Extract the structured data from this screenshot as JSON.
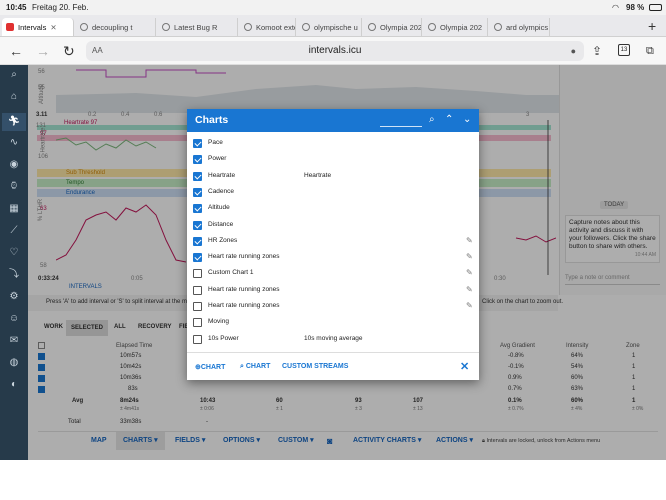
{
  "statusbar": {
    "time": "10:45",
    "date": "Freitag 20. Feb.",
    "battery": "98 %"
  },
  "tabs": [
    {
      "label": "Intervals"
    },
    {
      "label": "decoupling t"
    },
    {
      "label": "Latest Bug R"
    },
    {
      "label": "Komoot exte"
    },
    {
      "label": "olympische u"
    },
    {
      "label": "Olympia 202"
    },
    {
      "label": "Olympia 202"
    },
    {
      "label": "ard olympics"
    }
  ],
  "browser": {
    "url": "intervals.icu",
    "reader_size": "AA",
    "tab_count": "13"
  },
  "background": {
    "chart_labels": {
      "altitude": "Altitude",
      "heartrate": "Heartrate",
      "hr_pct": "% LTHR",
      "hr97": "Heartrate 97",
      "sub_threshold": "Sub Threshold",
      "tempo": "Tempo",
      "endurance": "Endurance",
      "y_56": "56",
      "y_55": "55",
      "y_311": "3.11",
      "y_131": "131",
      "y_97": "97",
      "y_106": "106",
      "y_63": "63",
      "y_58": "58",
      "x_02": "0.2",
      "x_04": "0.4",
      "x_06": "0.6",
      "x_005": "0:05",
      "x_030": "0:30",
      "x_3": "3",
      "elapsed_time": "0:33:24"
    },
    "intervals_label": "INTERVALS",
    "hint": "Press 'A' to add interval or 'S' to split interval at the mouse",
    "hint_right": "Click on the chart to zoom out.",
    "filter_tabs": [
      "WORK",
      "SELECTED",
      "ALL",
      "RECOVERY",
      "FIE"
    ],
    "table_headers": {
      "elapsed": "Elapsed Time",
      "gradient": "Avg Gradient",
      "intensity": "Intensity",
      "zone": "Zone"
    },
    "rows": [
      {
        "elapsed": "10m57s",
        "gradient": "-0.8%",
        "intensity": "64%",
        "zone": "1"
      },
      {
        "elapsed": "10m42s",
        "gradient": "-0.1%",
        "intensity": "54%",
        "zone": "1"
      },
      {
        "elapsed": "10m36s",
        "gradient": "0.9%",
        "intensity": "60%",
        "zone": "1"
      },
      {
        "elapsed": "83s",
        "gradient": "0.7%",
        "intensity": "63%",
        "zone": "1"
      }
    ],
    "avg": {
      "label": "Avg",
      "elapsed": "8m24s",
      "elapsed_sub": "± 4m41s",
      "c1": "10:43",
      "c1_sub": "± 0:06",
      "c2": "60",
      "c2_sub": "± 1",
      "c3": "93",
      "c3_sub": "± 3",
      "c4": "107",
      "c4_sub": "± 13",
      "gradient": "0.1%",
      "gradient_sub": "± 0.7%",
      "intensity": "60%",
      "intensity_sub": "± 4%",
      "zone": "1",
      "zone_sub": "± 0%"
    },
    "total": {
      "label": "Total",
      "elapsed": "33m38s",
      "c1": "-"
    },
    "bottom_tabs": {
      "map": "MAP",
      "charts": "CHARTS ▾",
      "fields": "FIELDS ▾",
      "options": "OPTIONS ▾",
      "custom": "CUSTOM ▾",
      "activity_charts": "ACTIVITY CHARTS ▾",
      "actions": "ACTIONS ▾",
      "locked": "Intervals are locked, unlock from Actions menu"
    },
    "right_panel": {
      "today": "TODAY",
      "note": "Capture notes about this activity and discuss it with your followers. Click the share button to share with others.",
      "note_time": "10:44 AM",
      "placeholder": "Type a note or comment"
    }
  },
  "dialog": {
    "title": "Charts",
    "rows": [
      {
        "label": "Pace",
        "sub": "",
        "checked": true,
        "editable": false
      },
      {
        "label": "Power",
        "sub": "",
        "checked": true,
        "editable": false
      },
      {
        "label": "Heartrate",
        "sub": "Heartrate",
        "checked": true,
        "editable": false
      },
      {
        "label": "Cadence",
        "sub": "",
        "checked": true,
        "editable": false
      },
      {
        "label": "Altitude",
        "sub": "",
        "checked": true,
        "editable": false
      },
      {
        "label": "Distance",
        "sub": "",
        "checked": true,
        "editable": false
      },
      {
        "label": "HR Zones",
        "sub": "",
        "checked": true,
        "editable": true
      },
      {
        "label": "Heart rate running zones",
        "sub": "",
        "checked": true,
        "editable": true
      },
      {
        "label": "Custom Chart 1",
        "sub": "",
        "checked": false,
        "editable": true
      },
      {
        "label": "Heart rate running zones",
        "sub": "",
        "checked": false,
        "editable": true
      },
      {
        "label": "Heart rate running zones",
        "sub": "",
        "checked": false,
        "editable": true
      },
      {
        "label": "Moving",
        "sub": "",
        "checked": false,
        "editable": false
      },
      {
        "label": "10s Power",
        "sub": "10s moving average",
        "checked": false,
        "editable": false
      }
    ],
    "footer": {
      "add_chart": "CHART",
      "find_chart": "CHART",
      "custom_streams": "CUSTOM STREAMS"
    }
  },
  "colors": {
    "accent": "#1976d2",
    "nav": "#263a4a",
    "hr_line": "#c2185b",
    "altitude_fill": "#cfd8dc"
  }
}
